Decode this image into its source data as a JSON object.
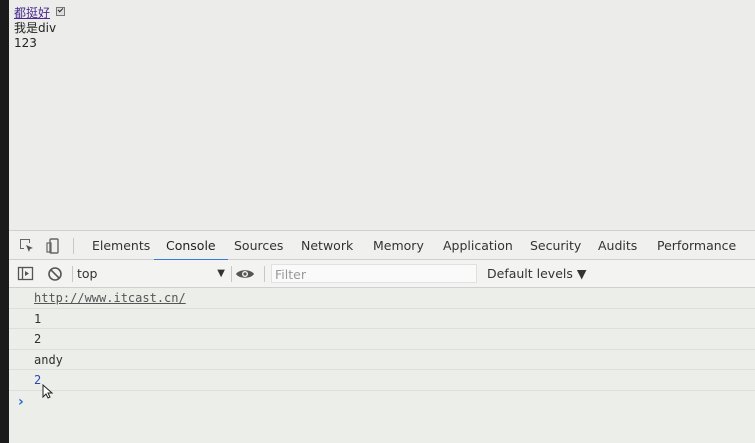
{
  "page": {
    "link_text": "都挺好",
    "div_text": "我是div",
    "number_text": "123"
  },
  "devtools": {
    "tabs": [
      "Elements",
      "Console",
      "Sources",
      "Network",
      "Memory",
      "Application",
      "Security",
      "Audits",
      "Performance"
    ],
    "active_tab": "Console",
    "context": "top",
    "filter_placeholder": "Filter",
    "levels": "Default levels ▼",
    "messages": [
      "http://www.itcast.cn/",
      "1",
      "2",
      "andy",
      "2"
    ],
    "prompt": "›"
  },
  "colors": {
    "accent": "#3879d9",
    "link": "#4a2a8c"
  }
}
